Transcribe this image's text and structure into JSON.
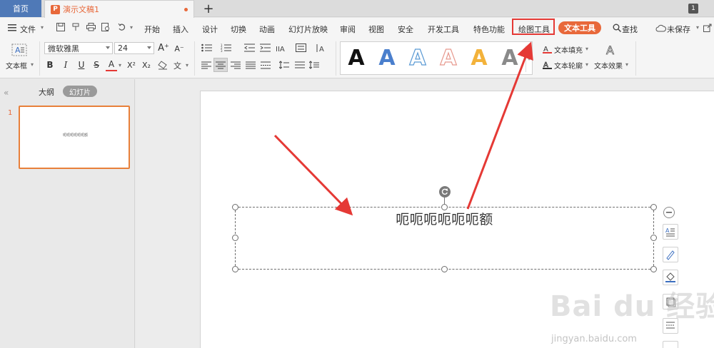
{
  "tabs": {
    "home": "首页",
    "doc_title": "演示文稿1",
    "doc_icon": "P",
    "add": "+",
    "window_badge": "1"
  },
  "menu": {
    "file": "文件",
    "items": [
      "开始",
      "插入",
      "设计",
      "切换",
      "动画",
      "幻灯片放映",
      "审阅",
      "视图",
      "安全",
      "开发工具",
      "特色功能",
      "绘图工具"
    ],
    "text_tool": "文本工具",
    "search": "查找",
    "unsaved": "未保存"
  },
  "ribbon": {
    "textbox_label": "文本框",
    "font_name": "微软雅黑",
    "font_size": "24",
    "bold": "B",
    "italic": "I",
    "underline": "U",
    "strike": "S",
    "font_color": "A",
    "superscript": "X²",
    "subscript": "X₂",
    "grow_font": "A⁺",
    "shrink_font": "A⁻",
    "style_letter": "A",
    "text_fill": "文本填充",
    "text_outline": "文本轮廓",
    "text_effect": "文本效果"
  },
  "colors": {
    "accent": "#e8683a",
    "home_tab": "#4f79b7",
    "highlight": "#e53935",
    "arrow": "#e53935"
  },
  "panel": {
    "outline_tab": "大纲",
    "slides_tab": "幻灯片",
    "slide_number": "1",
    "thumb_text": "呃呃呃呃呃呃额"
  },
  "slide": {
    "text": "呃呃呃呃呃呃额"
  },
  "watermark": {
    "main": "Bai du 经验",
    "sub": "jingyan.baidu.com"
  }
}
